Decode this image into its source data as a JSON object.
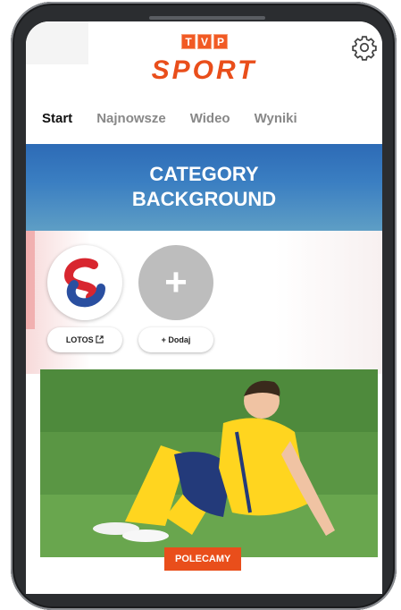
{
  "header": {
    "tvp_letters": [
      "T",
      "V",
      "P"
    ],
    "brand": "SPORT",
    "settings_icon": "gear-icon"
  },
  "tabs": [
    {
      "label": "Start",
      "active": true
    },
    {
      "label": "Najnowsze",
      "active": false
    },
    {
      "label": "Wideo",
      "active": false
    },
    {
      "label": "Wyniki",
      "active": false
    }
  ],
  "banner": {
    "line1": "CATEGORY",
    "line2": "BACKGROUND"
  },
  "clubs": {
    "items": [
      {
        "label": "LOTOS",
        "icon": "external-link-icon"
      },
      {
        "label": "+ Dodaj"
      }
    ],
    "add_symbol": "+"
  },
  "feature": {
    "badge": "POLECAMY"
  },
  "colors": {
    "accent": "#e94e1b",
    "banner_top": "#2d6bb6",
    "banner_bottom": "#5e9ec5"
  }
}
